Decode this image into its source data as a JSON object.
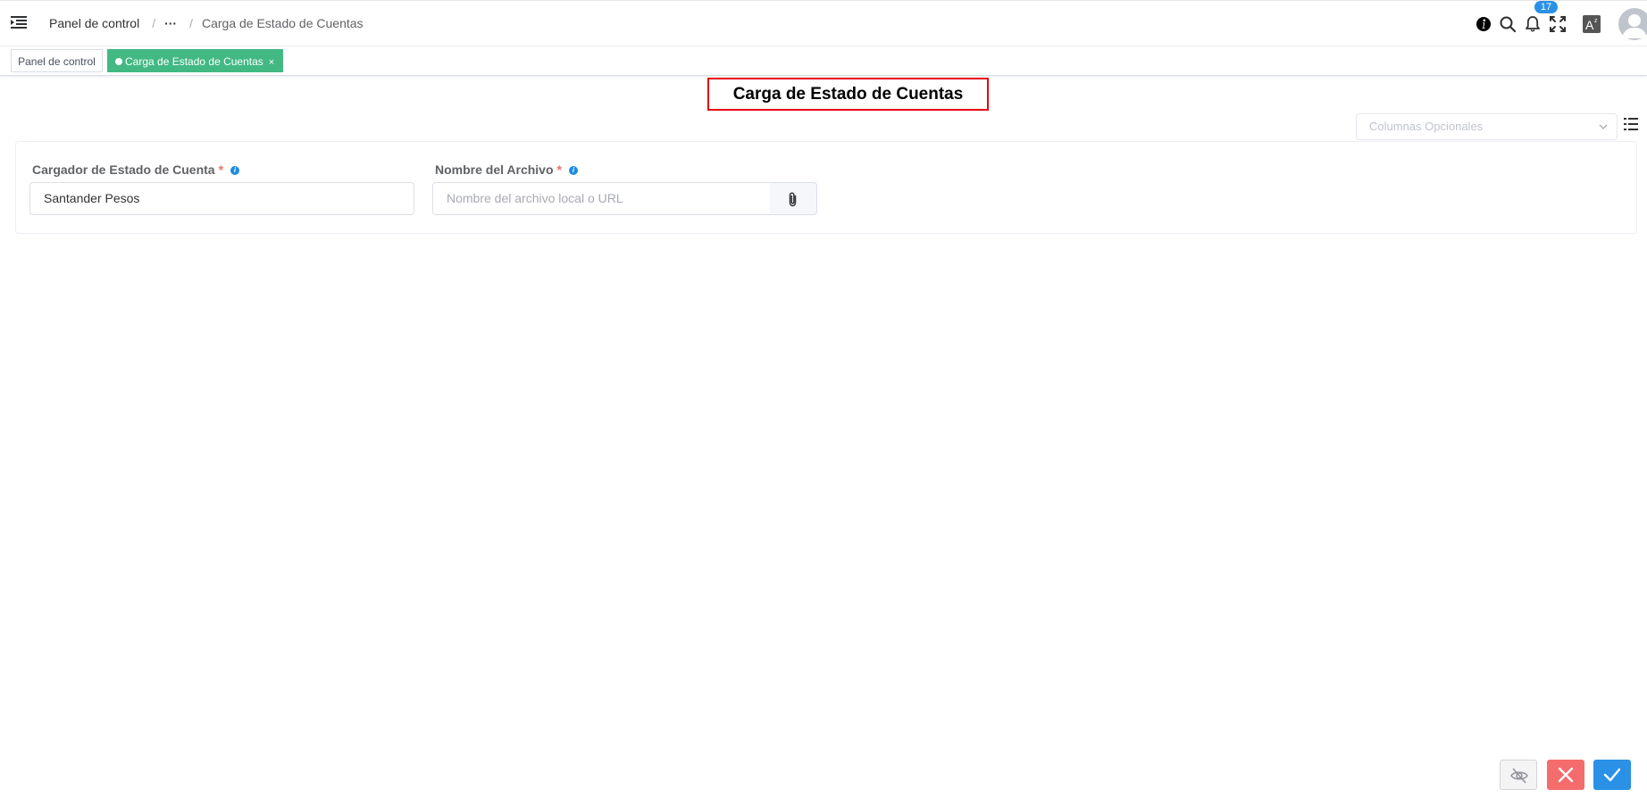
{
  "header": {
    "breadcrumb": {
      "home": "Panel de control",
      "separator": "/",
      "ellipsis": "···",
      "current": "Carga de Estado de Cuentas"
    },
    "notifications_count": "17",
    "icons": [
      "menu-toggle-icon",
      "info-icon",
      "search-icon",
      "bell-icon",
      "fullscreen-icon",
      "text-size-icon",
      "user-avatar-icon"
    ]
  },
  "tags": {
    "home": "Panel de control",
    "active": "Carga de Estado de Cuentas",
    "close": "×"
  },
  "page": {
    "title": "Carga de Estado de Cuentas",
    "optional_columns_placeholder": "Columnas Opcionales"
  },
  "form": {
    "loader_label": "Cargador de Estado de Cuenta",
    "loader_value": "Santander Pesos",
    "file_label": "Nombre del Archivo",
    "file_placeholder": "Nombre del archivo local o URL",
    "required_mark": "*",
    "info_mark": "i"
  },
  "colors": {
    "active_tag": "#42b983",
    "title_border": "#e60012",
    "cancel": "#f56c6c",
    "confirm": "#2a91e6",
    "badge": "#2a91e6"
  }
}
